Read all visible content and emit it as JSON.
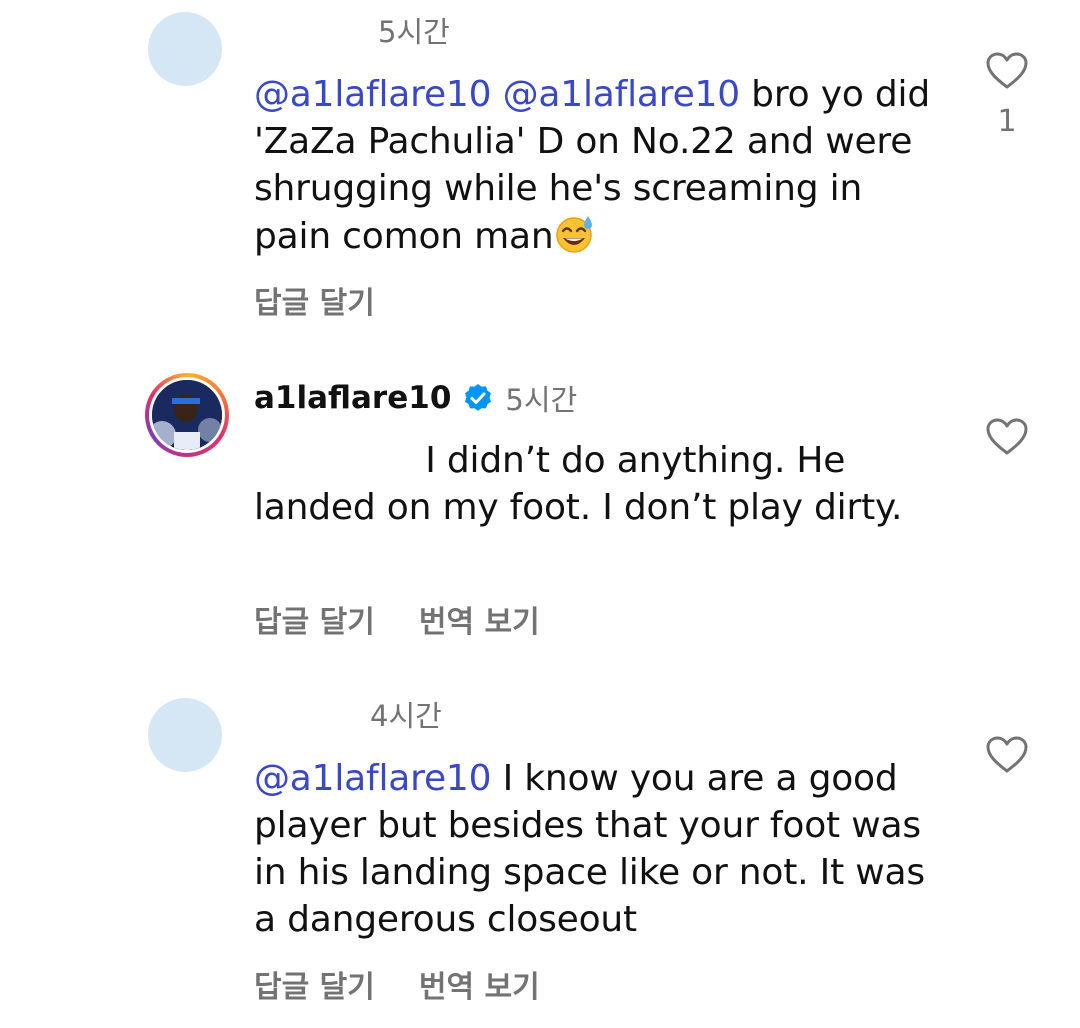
{
  "comments": [
    {
      "time": "5시간",
      "mention1": "@a1laflare10",
      "mention2": "@a1laflare10",
      "text": " bro yo did 'ZaZa Pachulia' D on No.22 and were shrugging while he's screaming in pain comon man",
      "emoji": "sweat-smile-emoji",
      "reply_label": "답글 달기",
      "like_count": "1"
    },
    {
      "username": "a1laflare10",
      "time": "5시간",
      "text": "I didn’t do anything. He landed on my foot. I don’t play dirty.",
      "reply_label": "답글 달기",
      "translate_label": "번역 보기"
    },
    {
      "time": "4시간",
      "mention1": "@a1laflare10",
      "text": " I know you are a good player but besides that your foot was in his landing space like or not. It was a dangerous closeout",
      "reply_label": "답글 달기",
      "translate_label": "번역 보기"
    }
  ],
  "colors": {
    "mention": "#3848c8",
    "muted": "#737373",
    "avatar_placeholder": "#d5e6f5",
    "verified": "#0095f6"
  }
}
